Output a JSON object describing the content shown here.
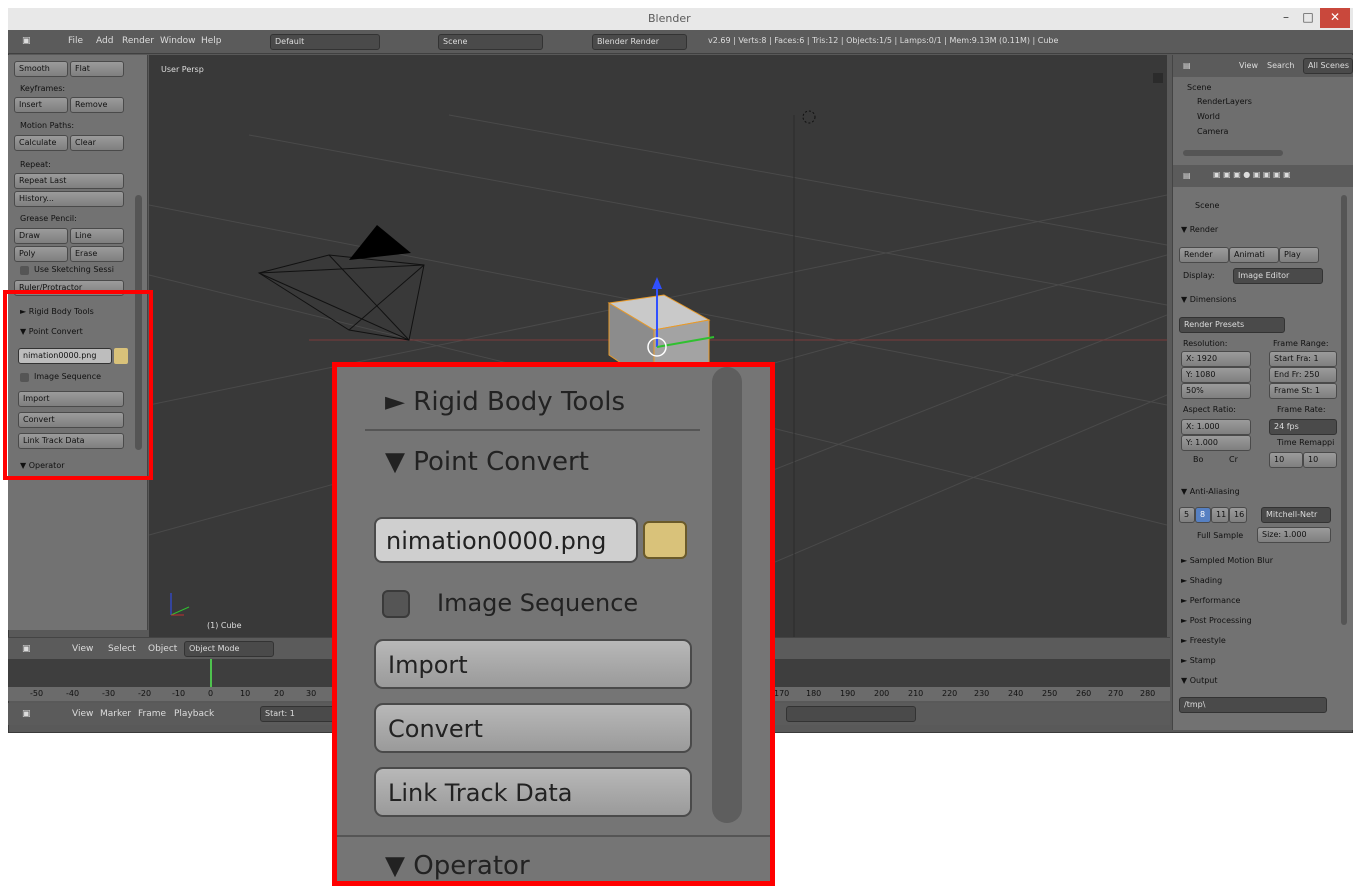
{
  "window": {
    "title": "Blender"
  },
  "menubar": {
    "items": [
      "File",
      "Add",
      "Render",
      "Window",
      "Help"
    ],
    "layout": "Default",
    "scene": "Scene",
    "engine": "Blender Render",
    "stats": "v2.69 | Verts:8 | Faces:6 | Tris:12 | Objects:1/5 | Lamps:0/1 | Mem:9.13M (0.11M) | Cube"
  },
  "toolshelf": {
    "smooth": "Smooth",
    "flat": "Flat",
    "keyframes": "Keyframes:",
    "insert": "Insert",
    "remove": "Remove",
    "motion_paths": "Motion Paths:",
    "calculate": "Calculate",
    "clear": "Clear",
    "repeat": "Repeat:",
    "repeat_last": "Repeat Last",
    "history": "History...",
    "grease_pencil": "Grease Pencil:",
    "draw": "Draw",
    "line": "Line",
    "poly": "Poly",
    "erase": "Erase",
    "use_sketching": "Use Sketching Sessi",
    "ruler": "Ruler/Protractor",
    "rigid_body": "► Rigid Body Tools",
    "point_convert": "▼ Point Convert",
    "file_path": "nimation0000.png",
    "image_sequence": "Image Sequence",
    "import": "Import",
    "convert": "Convert",
    "link_track": "Link Track Data",
    "operator": "▼ Operator"
  },
  "viewport": {
    "label": "User Persp",
    "object": "(1) Cube"
  },
  "outliner": {
    "view": "View",
    "search": "Search",
    "all_scenes": "All Scenes",
    "items": [
      "Scene",
      "RenderLayers",
      "World",
      "Camera"
    ]
  },
  "properties": {
    "scene": "Scene",
    "render_panel": "▼ Render",
    "render_btn": "Render",
    "anim_btn": "Animati",
    "play_btn": "Play",
    "display_label": "Display:",
    "display_value": "Image Editor",
    "dimensions": "▼ Dimensions",
    "render_presets": "Render Presets",
    "resolution": "Resolution:",
    "frame_range": "Frame Range:",
    "res_x": "X: 1920",
    "res_y": "Y: 1080",
    "res_pct": "50%",
    "start": "Start Fra: 1",
    "end": "End Fr: 250",
    "step": "Frame St: 1",
    "aspect": "Aspect Ratio:",
    "frame_rate": "Frame Rate:",
    "asp_x": "X: 1.000",
    "asp_y": "Y: 1.000",
    "fps": "24 fps",
    "time_remap": "Time Remappi",
    "bo": "Bo",
    "cr": "Cr",
    "old": "10",
    "new": "10",
    "anti_aliasing": "▼ Anti-Aliasing",
    "aa_samples": [
      "5",
      "8",
      "11",
      "16"
    ],
    "filter": "Mitchell-Netr",
    "full_sample": "Full Sample",
    "size": "Size: 1.000",
    "sampled_motion_blur": "► Sampled Motion Blur",
    "shading": "► Shading",
    "performance": "► Performance",
    "post_processing": "► Post Processing",
    "freestyle": "► Freestyle",
    "stamp": "► Stamp",
    "output": "▼ Output",
    "output_path": "/tmp\\"
  },
  "header3d": {
    "view": "View",
    "select": "Select",
    "object": "Object",
    "mode": "Object Mode"
  },
  "timeline": {
    "ticks": [
      "-50",
      "-40",
      "-30",
      "-20",
      "-10",
      "0",
      "10",
      "20",
      "30",
      "170",
      "180",
      "190",
      "200",
      "210",
      "220",
      "230",
      "240",
      "250",
      "260",
      "270",
      "280"
    ],
    "view": "View",
    "marker": "Marker",
    "frame": "Frame",
    "playback": "Playback",
    "start": "Start: 1"
  },
  "zoom": {
    "rigid_body": "► Rigid Body Tools",
    "point_convert": "▼ Point Convert",
    "file_path": "nimation0000.png",
    "image_sequence": "Image Sequence",
    "import": "Import",
    "convert": "Convert",
    "link_track": "Link Track Data",
    "operator": "▼ Operator"
  },
  "colors": {
    "highlight": "#ff0000",
    "viewport_bg": "#393939",
    "panel_bg": "#727272"
  }
}
